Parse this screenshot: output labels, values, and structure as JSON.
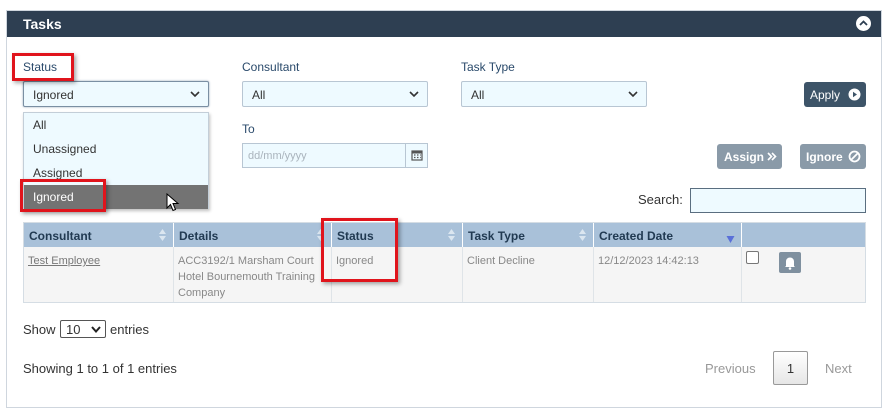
{
  "panel": {
    "title": "Tasks"
  },
  "filters": {
    "status": {
      "label": "Status",
      "value": "Ignored"
    },
    "consultant": {
      "label": "Consultant",
      "value": "All"
    },
    "task_type": {
      "label": "Task Type",
      "value": "All"
    },
    "to": {
      "label": "To",
      "placeholder": "dd/mm/yyyy"
    }
  },
  "status_dropdown": {
    "options": [
      "All",
      "Unassigned",
      "Assigned",
      "Ignored"
    ],
    "highlighted": "Ignored"
  },
  "buttons": {
    "apply": "Apply",
    "assign": "Assign",
    "ignore": "Ignore"
  },
  "search": {
    "label": "Search:"
  },
  "table": {
    "columns": [
      "Consultant",
      "Details",
      "Status",
      "Task Type",
      "Created Date"
    ],
    "rows": [
      {
        "consultant": "Test Employee",
        "details_lines": [
          "ACC3192/1 Marsham Court",
          "Hotel Bournemouth Training",
          "Company"
        ],
        "status": "Ignored",
        "task_type": "Client Decline",
        "created_date": "12/12/2023 14:42:13"
      }
    ]
  },
  "length": {
    "show": "Show",
    "value": "10",
    "entries": "entries"
  },
  "info": "Showing 1 to 1 of 1 entries",
  "pagination": {
    "previous": "Previous",
    "current": "1",
    "next": "Next"
  },
  "colors": {
    "header": "#2e3f52",
    "table_header": "#a9c1d9",
    "highlight": "#e0141c",
    "input_bg": "#eefaff"
  },
  "icons": [
    "chevron-up-icon",
    "chevron-down-icon",
    "play-circle-icon",
    "double-chevron-right-icon",
    "ban-icon",
    "calendar-icon",
    "sort-icon",
    "bell-icon",
    "mouse-cursor-icon"
  ]
}
